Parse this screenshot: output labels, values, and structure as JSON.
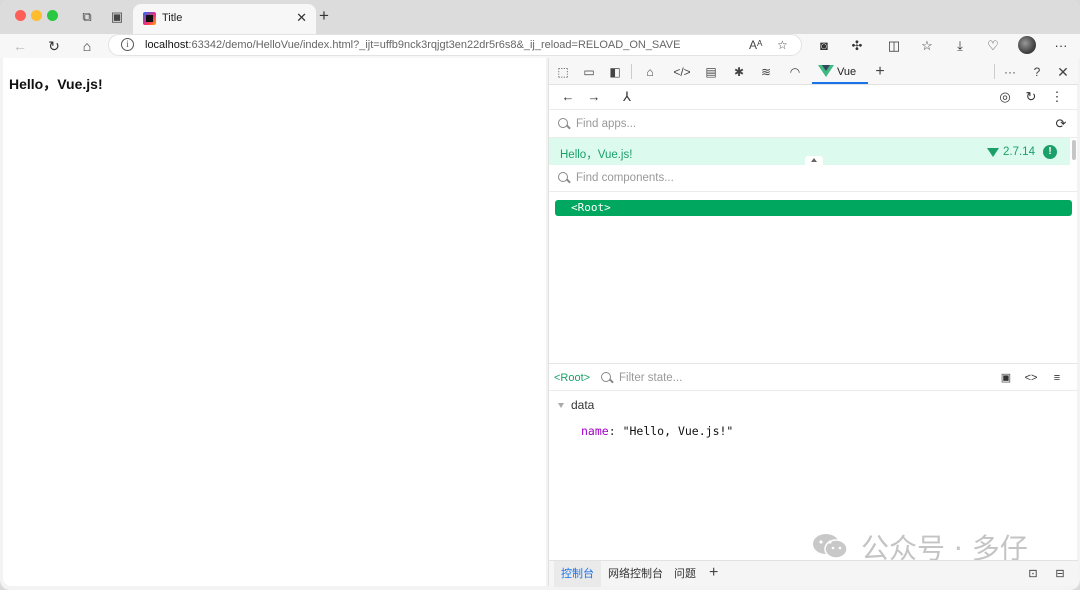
{
  "browser": {
    "tab_title": "Title",
    "url_host": "localhost",
    "url_rest": ":63342/demo/HelloVue/index.html?_ijt=uffb9nck3rqjgt3en22dr5r6s8&_ij_reload=RELOAD_ON_SAVE",
    "read_aloud_label": "Aᴬ"
  },
  "page": {
    "heading": "Hello，Vue.js!"
  },
  "devtools": {
    "active_tab_label": "Vue",
    "find_apps_placeholder": "Find apps...",
    "app_name": "Hello，Vue.js!",
    "vue_version": "2.7.14",
    "badge": "!",
    "find_components_placeholder": "Find components...",
    "root_component": "<Root>",
    "state_root": "<Root>",
    "filter_state_placeholder": "Filter state...",
    "data_section": "data",
    "data_key": "name",
    "data_value": "\"Hello, Vue.js!\""
  },
  "console_bar": {
    "tabs": [
      "控制台",
      "网络控制台",
      "问题"
    ],
    "active_tab": "控制台"
  },
  "watermark": {
    "text": "公众号 · 多仔"
  },
  "colors": {
    "vue_green": "#42b883",
    "selected_green": "#00a85f",
    "app_row_bg": "#dcfaee",
    "accent_blue": "#1a73e8"
  }
}
